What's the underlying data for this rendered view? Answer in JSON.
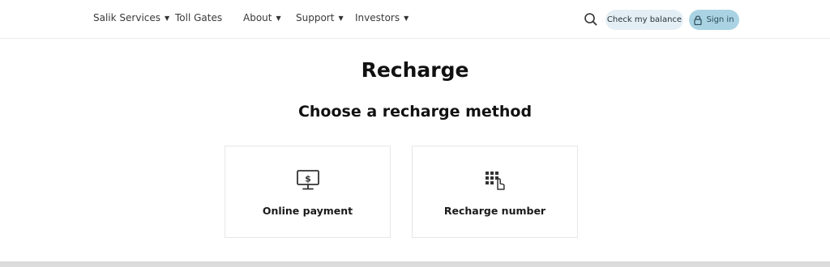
{
  "nav": {
    "items": [
      {
        "label": "Salik Services",
        "has_caret": true
      },
      {
        "label": "Toll Gates",
        "has_caret": false
      },
      {
        "label": "About",
        "has_caret": true
      },
      {
        "label": "Support",
        "has_caret": true
      },
      {
        "label": "Investors",
        "has_caret": true
      }
    ],
    "search_icon": "search-icon",
    "check_balance_label": "Check my balance",
    "sign_in_label": "Sign in",
    "sign_in_icon": "lock-icon"
  },
  "main": {
    "title": "Recharge",
    "subtitle": "Choose a recharge method",
    "methods": [
      {
        "label": "Online payment",
        "icon": "monitor-dollar-icon"
      },
      {
        "label": "Recharge number",
        "icon": "keypad-tap-icon"
      }
    ]
  },
  "colors": {
    "balance_button_bg": "#e4eff5",
    "signin_button_bg": "#a9d3e3"
  }
}
